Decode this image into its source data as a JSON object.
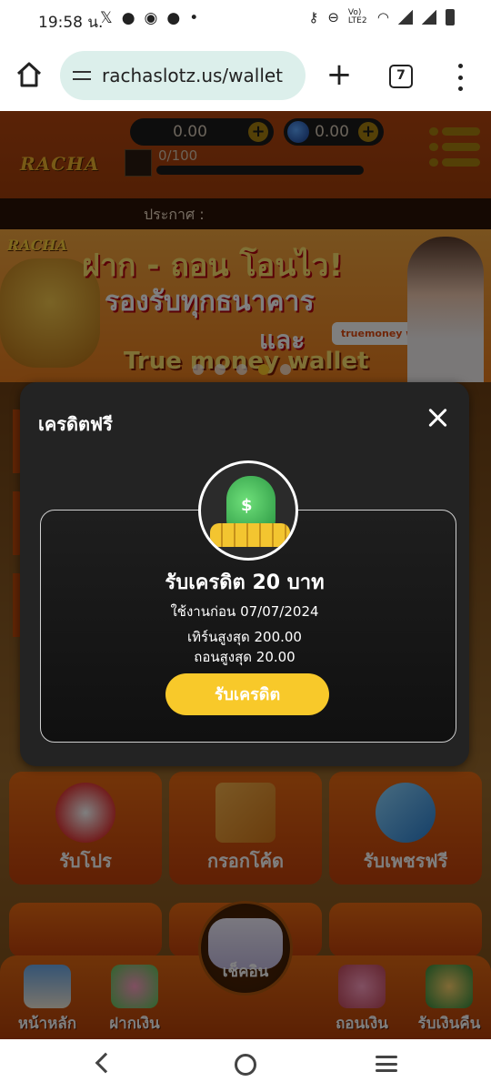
{
  "status_bar": {
    "time": "19:58 น.",
    "icons_left": [
      "x-icon",
      "chat-icon",
      "compass-icon",
      "line-icon"
    ],
    "dot": "•",
    "volte": "Vo) LTE2"
  },
  "browser": {
    "url": "rachaslotz.us/wallet",
    "tab_count": "7"
  },
  "site": {
    "logo": "RACHA",
    "balance": "0.00",
    "gems": "0.00",
    "level": "0/100",
    "level_progress": 0,
    "announcement_label": "ประกาศ :",
    "accent_color": "#f8c92a"
  },
  "banner": {
    "logo": "RACHA",
    "line1": "ฝาก - ถอน โอนไว!",
    "line2": "รองรับทุกธนาคาร",
    "line3": "และ",
    "line4": "True money wallet",
    "badge": "truemoney wallet"
  },
  "tiles": [
    {
      "label": "รับโปร",
      "icon": "megaphone-icon"
    },
    {
      "label": "กรอกโค้ด",
      "icon": "coupon-icon"
    },
    {
      "label": "รับเพชรฟรี",
      "icon": "diamond-icon"
    }
  ],
  "bottom_nav": {
    "items": [
      {
        "label": "หน้าหลัก",
        "icon": "house-icon"
      },
      {
        "label": "ฝากเงิน",
        "icon": "piggy-up-icon"
      },
      {
        "label": "เช็คอิน",
        "icon": "gamepad-icon"
      },
      {
        "label": "ถอนเงิน",
        "icon": "piggy-down-icon"
      },
      {
        "label": "รับเงินคืน",
        "icon": "cashback-icon"
      }
    ]
  },
  "modal": {
    "title": "เครดิตฟรี",
    "heading": "รับเครดิต 20 บาท",
    "expire": "ใช้งานก่อน 07/07/2024",
    "turnover": "เทิร์นสูงสุด 200.00",
    "withdraw": "ถอนสูงสุด 20.00",
    "claim_label": "รับเครดิต"
  }
}
